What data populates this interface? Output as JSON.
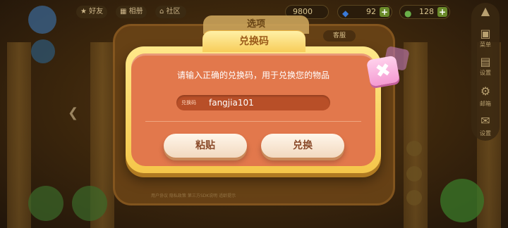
{
  "top_bar": {
    "friends_label": "好友",
    "album_label": "相册",
    "community_label": "社区",
    "coins": "9800",
    "gems": "92",
    "energy": "128"
  },
  "right_menu": {
    "items": [
      "菜单",
      "设置",
      "邮箱",
      "设置"
    ]
  },
  "back_panel": {
    "title": "选项",
    "help_chip": "客服",
    "footer": "用户协议 隐私政策 第三方SDK说明 适龄提示"
  },
  "dialog": {
    "title": "兑换码",
    "instruction": "请输入正确的兑换码，用于兑换您的物品",
    "code_label": "兑换码",
    "code_value": "fangjia101",
    "paste_label": "粘贴",
    "redeem_label": "兑换",
    "close_glyph": "✖"
  },
  "colors": {
    "dialog_body": "#e2784c",
    "dialog_frame": "#f5c64a",
    "close_button": "#f49ad2"
  }
}
